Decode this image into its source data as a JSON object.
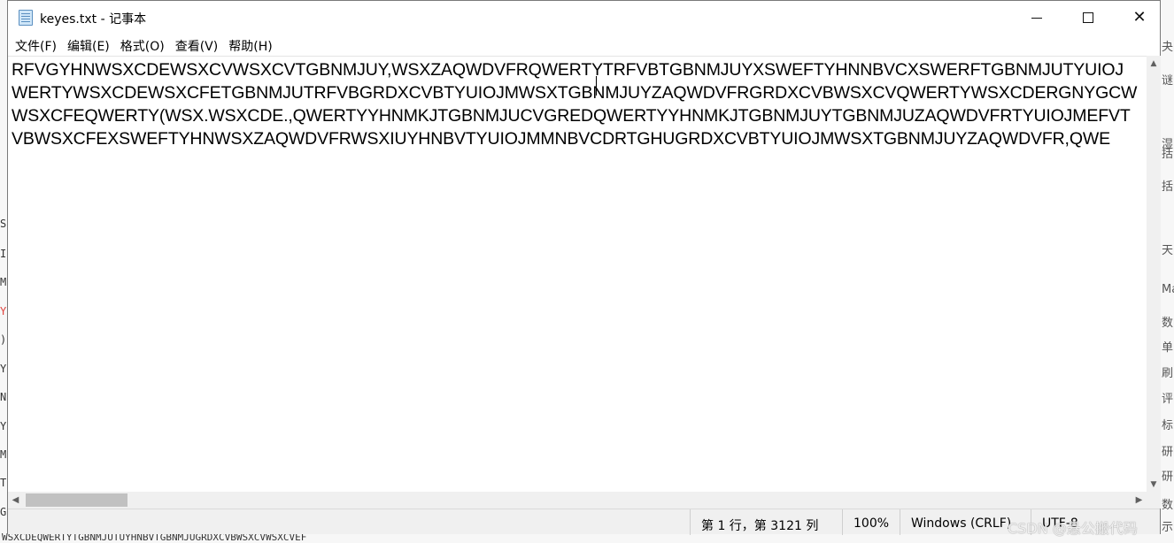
{
  "window": {
    "title": "keyes.txt - 记事本",
    "icon": "notepad-icon",
    "minimize_label": "—",
    "maximize_label": "☐",
    "close_label": "✕"
  },
  "menu": [
    {
      "label": "文件(F)"
    },
    {
      "label": "编辑(E)"
    },
    {
      "label": "格式(O)"
    },
    {
      "label": "查看(V)"
    },
    {
      "label": "帮助(H)"
    }
  ],
  "editor": {
    "lines": [
      "RFVGYHNWSXCDEWSXCVWSXCVTGBNMJUY,WSXZAQWDVFRQWERTYTRFVBTGBNMJUYXSWEFTYHNNBVCXSWERFTGBNMJUTYUIOJ",
      "WERTYWSXCDEWSXCFETGBNMJUTRFVBGRDXCVBTYUIOJMWSXTGBNMJUYZAQWDVFRGRDXCVBWSXCVQWERTYWSXCDERGNYGCW",
      "WSXCFEQWERTY(WSX.WSXCDE.,QWERTYYHNMKJTGBNMJUCVGREDQWERTYYHNMKJTGBNMJUYTGBNMJUZAQWDVFRTYUIOJMEFVT",
      "VBWSXCFEXSWEFTYHNWSXZAQWDVFRWSXIUYHNBVTYUIOJMMNBVCDRTGHUGRDXCVBTYUIOJMWSXTGBNMJUYZAQWDVFR,QWE"
    ]
  },
  "statusbar": {
    "position": "第 1 行，第 3121 列",
    "zoom": "100%",
    "line_ending": "Windows (CRLF)",
    "encoding": "UTF-8"
  },
  "watermark": "CSDN @悬公搬代码",
  "background": {
    "left_glyphs": [
      "S",
      "I",
      "M",
      "Y",
      ")",
      "Y",
      "N",
      "Y",
      "M",
      "T",
      "G"
    ],
    "left_glyph_highlight_color": "#e0443e",
    "bottom_text": "WSXCDEQWERTYTGBNMJUTUYHNBVTGBNMJUGRDXCVBWSXCVWSXCVEF",
    "right_glyphs": [
      "夬",
      "谜",
      "湿",
      "括",
      "括",
      "天",
      "Ma",
      "数",
      "单",
      "刷",
      "评",
      "标",
      "研",
      "研",
      "数",
      "示"
    ]
  }
}
